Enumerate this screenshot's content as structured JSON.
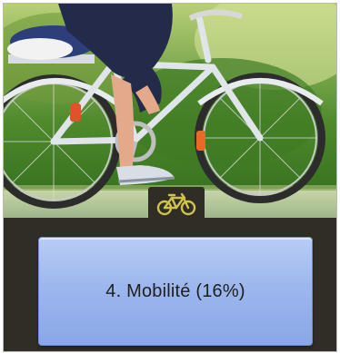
{
  "category": {
    "label": "4. Mobilité (16%)",
    "icon": "bicycle-icon"
  },
  "photo": {
    "subject": "cyclist-photo"
  },
  "colors": {
    "tile_bg": "#302d26",
    "icon_color": "#cfc34a",
    "card_top": "#b8ccf4",
    "card_bottom": "#8aa7e6"
  }
}
